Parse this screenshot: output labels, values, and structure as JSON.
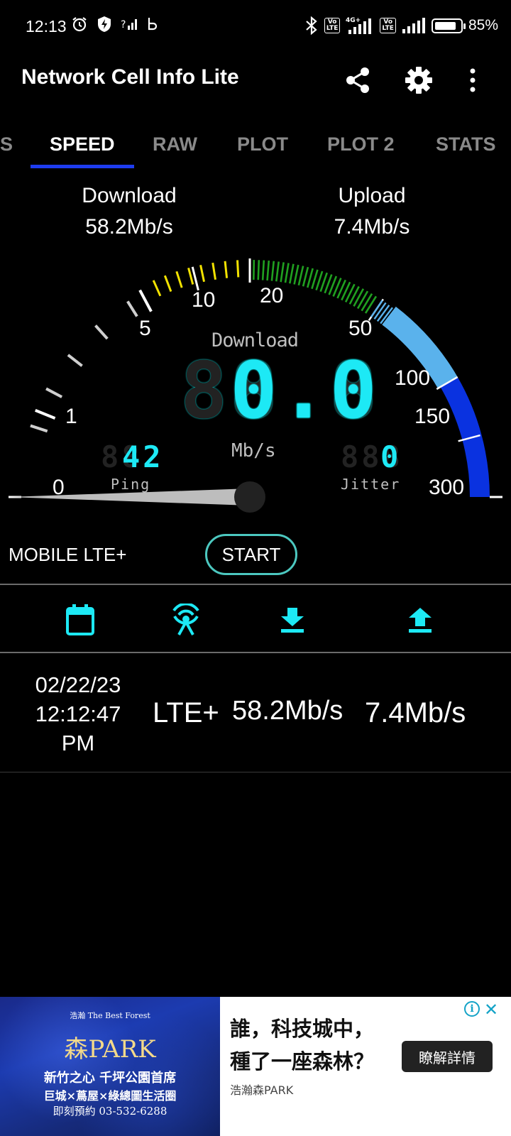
{
  "status_bar": {
    "time": "12:13",
    "battery_percent": "85%",
    "battery_level": 0.85,
    "network_label": "4G+",
    "volte_label": "Vo LTE",
    "icons_left": [
      "alarm-icon",
      "shield-bolt-icon",
      "signal-question-icon",
      "b-icon"
    ],
    "icons_right": [
      "bluetooth-icon",
      "volte-icon",
      "signal-icon",
      "volte-icon",
      "signal-icon",
      "battery-icon"
    ]
  },
  "app_bar": {
    "title": "Network Cell Info Lite",
    "actions": [
      "share-icon",
      "settings-icon",
      "more-vert-icon"
    ]
  },
  "tabs": {
    "items": [
      "S",
      "SPEED",
      "RAW",
      "PLOT",
      "PLOT 2",
      "STATS"
    ],
    "active": "SPEED"
  },
  "summary": {
    "download_label": "Download",
    "download_value": "58.2Mb/s",
    "upload_label": "Upload",
    "upload_value": "7.4Mb/s"
  },
  "gauge": {
    "mode": "Download",
    "reading": "0.0",
    "reading_ghost": "88.8",
    "unit": "Mb/s",
    "ping_label": "Ping",
    "ping_value": "42",
    "ping_ghost": "88",
    "jitter_label": "Jitter",
    "jitter_value": "0",
    "jitter_ghost": "888",
    "scale_labels": [
      "0",
      "1",
      "5",
      "10",
      "20",
      "50",
      "100",
      "150",
      "300"
    ],
    "needle_value": 0,
    "colors": {
      "low": "#ffffff",
      "yellow": "#f2e200",
      "green": "#20a020",
      "light_blue": "#5ab2ec",
      "blue": "#0a32e0",
      "digits": "#1de9f5"
    }
  },
  "connection": {
    "type_label": "MOBILE LTE+",
    "start_label": "START"
  },
  "history_header": {
    "icons": [
      "calendar-icon",
      "antenna-icon",
      "download-icon",
      "upload-icon"
    ],
    "icon_color": "#1de9f5"
  },
  "history": [
    {
      "date": "02/22/23",
      "time": "12:12:47",
      "ampm": "PM",
      "network": "LTE+",
      "download": "58.2Mb/s",
      "upload": "7.4Mb/s"
    }
  ],
  "ad": {
    "image_brand_small": "浩瀚 The Best Forest",
    "image_title": "森PARK",
    "image_line1": "新竹之心 千坪公園首席",
    "image_line2": "巨城×蔦屋×綠總圖生活圈",
    "image_line3": "即刻預約 03-532-6288",
    "headline_line1": "誰，科技城中，",
    "headline_line2": "種了一座森林？",
    "source": "浩瀚森PARK",
    "cta": "瞭解詳情",
    "info_label": "i",
    "close_label": "✕"
  }
}
